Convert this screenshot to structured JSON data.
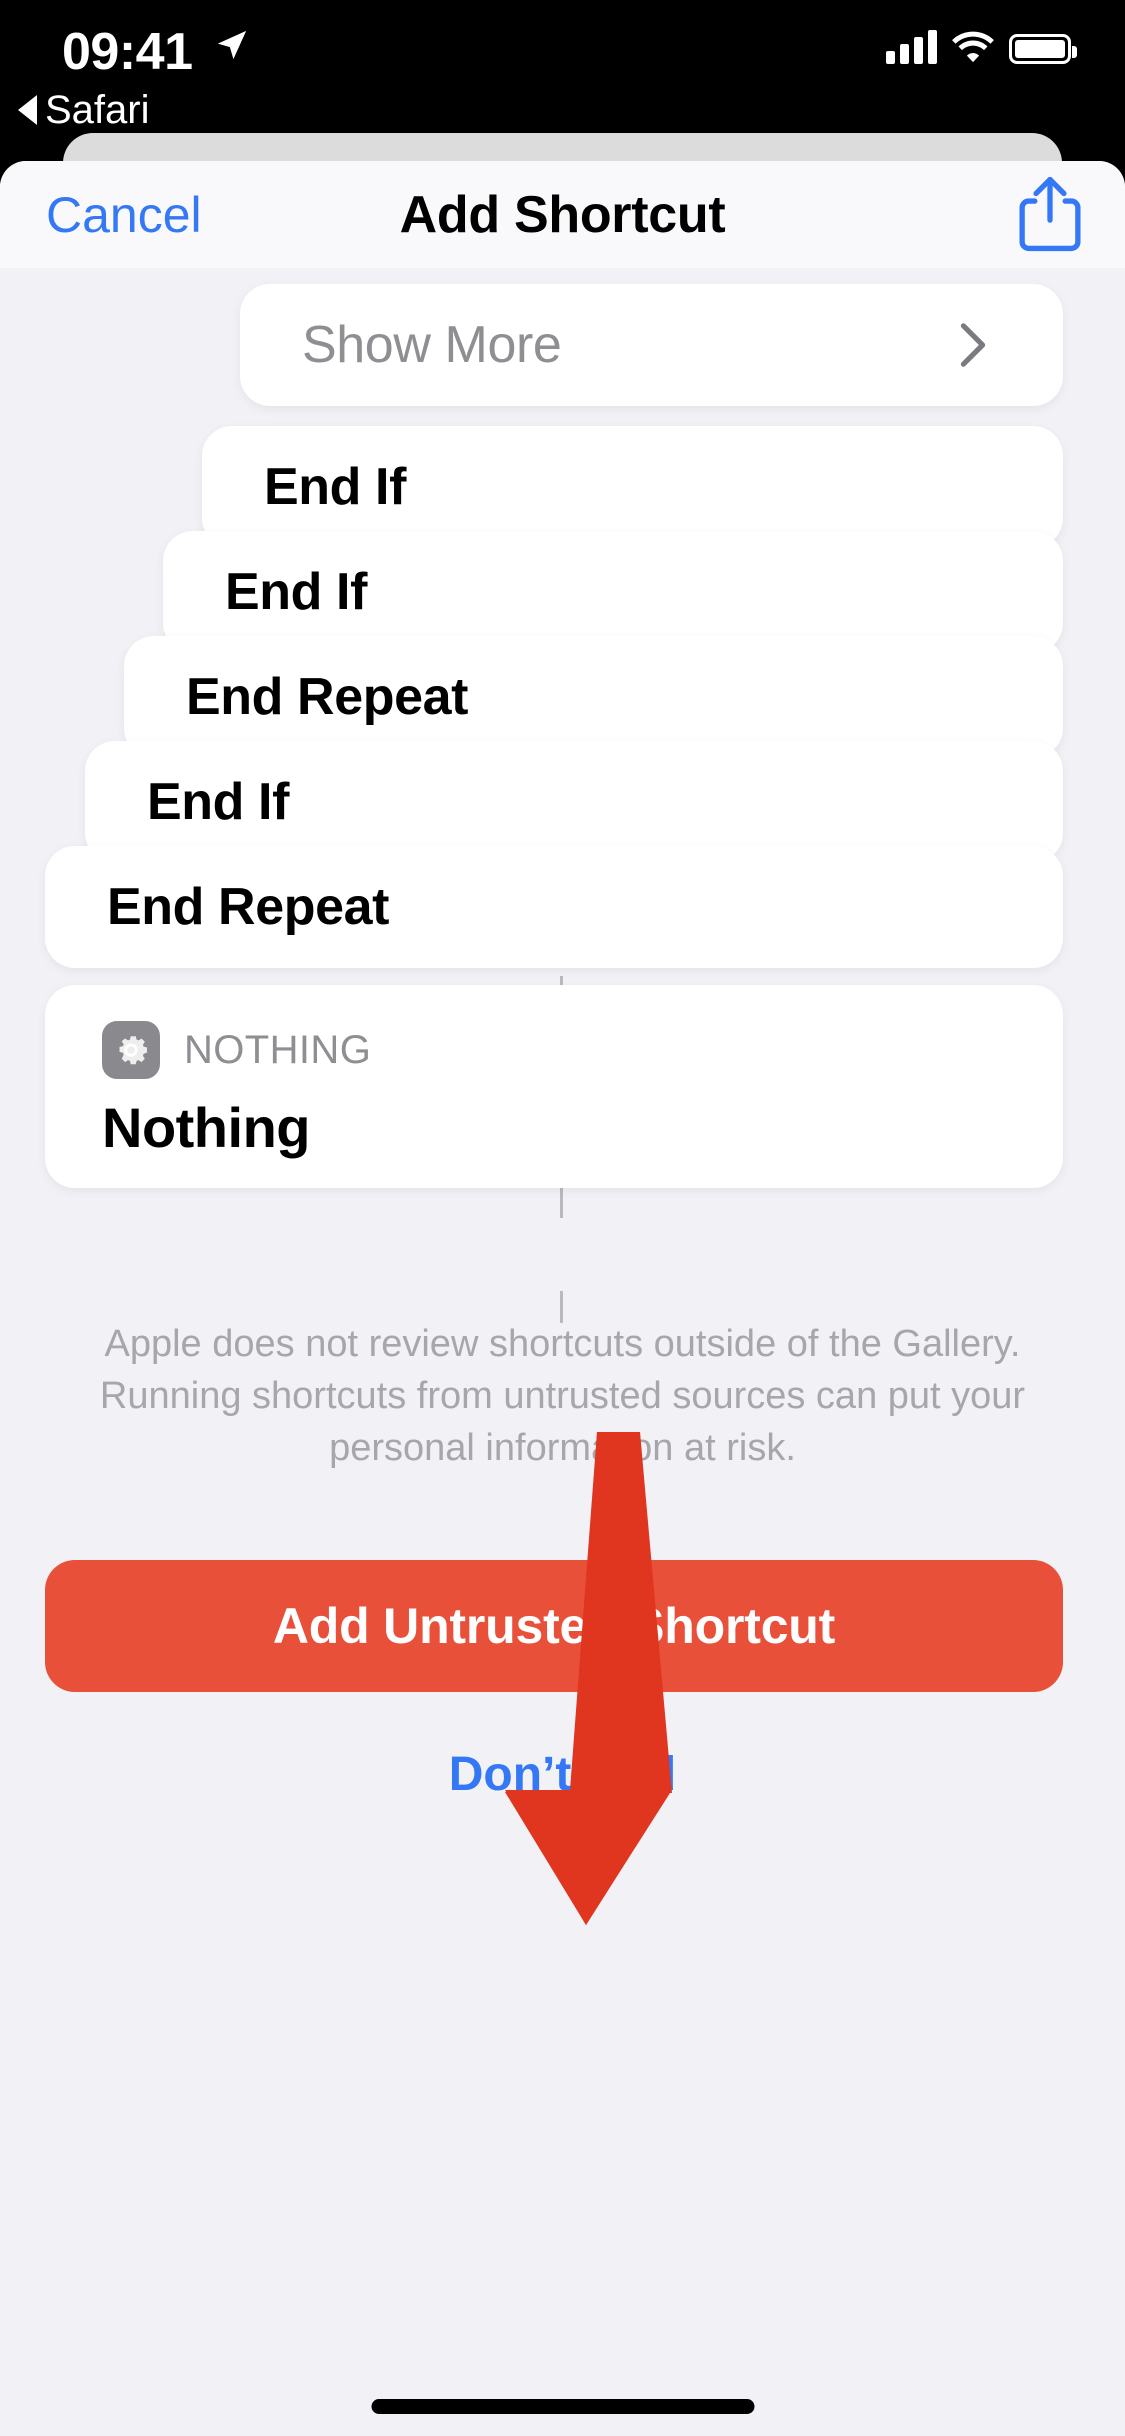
{
  "status_bar": {
    "time": "09:41",
    "location_icon": "location-arrow-icon",
    "back_label": "Safari",
    "signal_icon": "cellular-bars-icon",
    "wifi_icon": "wifi-icon",
    "battery_icon": "battery-full-icon"
  },
  "navbar": {
    "cancel_label": "Cancel",
    "title": "Add Shortcut",
    "share_icon": "share-icon"
  },
  "actions": [
    {
      "label": "Show More",
      "muted": true,
      "chevron": "chevron-right-icon"
    },
    {
      "label": "End If",
      "muted": false,
      "chevron": null
    },
    {
      "label": "End If",
      "muted": false,
      "chevron": null
    },
    {
      "label": "End Repeat",
      "muted": false,
      "chevron": null
    },
    {
      "label": "End If",
      "muted": false,
      "chevron": null
    },
    {
      "label": "End Repeat",
      "muted": false,
      "chevron": null
    }
  ],
  "nothing_card": {
    "icon": "gear-icon",
    "kicker": "NOTHING",
    "title": "Nothing"
  },
  "disclaimer": "Apple does not review shortcuts outside of the Gallery. Running shortcuts from untrusted sources can put your personal information at risk.",
  "primary_button": {
    "label": "Add Untrusted Shortcut"
  },
  "secondary_button": {
    "label": "Don’t Add"
  },
  "annotation": {
    "type": "arrow-down",
    "color": "#e0351e",
    "points_to": "Add Untrusted Shortcut"
  },
  "colors": {
    "accent_blue": "#3478f6",
    "danger_red": "#e8503a",
    "annotation_red": "#e0351e",
    "sheet_background": "#f2f1f6",
    "card_background": "#ffffff",
    "muted_text": "#8e8e93"
  },
  "home_indicator": "home-indicator"
}
